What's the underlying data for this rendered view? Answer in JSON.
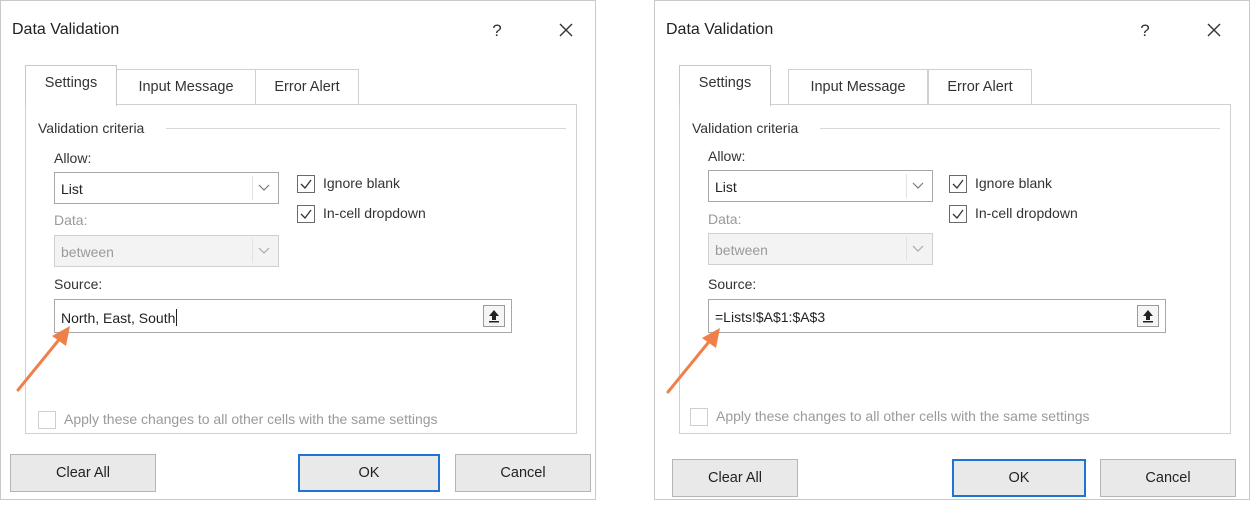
{
  "dialogs": [
    {
      "title": "Data Validation",
      "help": "?",
      "tabs": [
        "Settings",
        "Input Message",
        "Error Alert"
      ],
      "criteria_label": "Validation criteria",
      "allow_label": "Allow:",
      "allow_value": "List",
      "data_label": "Data:",
      "data_value": "between",
      "ignore_blank": "Ignore blank",
      "ignore_blank_checked": true,
      "in_cell_dropdown": "In-cell dropdown",
      "in_cell_dropdown_checked": true,
      "source_label": "Source:",
      "source_value": "North, East, South",
      "apply_label": "Apply these changes to all other cells with the same settings",
      "apply_checked": false,
      "buttons": {
        "clear_all": "Clear All",
        "ok": "OK",
        "cancel": "Cancel"
      }
    },
    {
      "title": "Data Validation",
      "help": "?",
      "tabs": [
        "Settings",
        "Input Message",
        "Error Alert"
      ],
      "criteria_label": "Validation criteria",
      "allow_label": "Allow:",
      "allow_value": "List",
      "data_label": "Data:",
      "data_value": "between",
      "ignore_blank": "Ignore blank",
      "ignore_blank_checked": true,
      "in_cell_dropdown": "In-cell dropdown",
      "in_cell_dropdown_checked": true,
      "source_label": "Source:",
      "source_value": "=Lists!$A$1:$A$3",
      "apply_label": "Apply these changes to all other cells with the same settings",
      "apply_checked": false,
      "buttons": {
        "clear_all": "Clear All",
        "ok": "OK",
        "cancel": "Cancel"
      }
    }
  ],
  "colors": {
    "accent_ok_border": "#1f73d1",
    "annotation_arrow": "#f0804a",
    "disabled_text": "#9a9a9a"
  },
  "icons": [
    "close-icon",
    "chevron-down-icon",
    "checkmark-icon",
    "collapse-dialog-icon",
    "annotation-arrow"
  ]
}
